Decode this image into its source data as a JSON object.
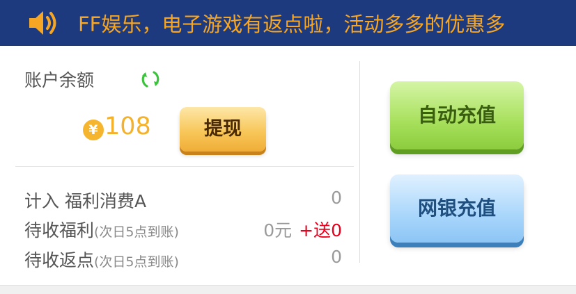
{
  "banner": {
    "icon": "speaker-icon",
    "text": "FF娱乐，电子游戏有返点啦，活动多多的优惠多",
    "bg_color": "#1e3a7e",
    "text_color": "#f6a623"
  },
  "account": {
    "balance_label": "账户余额",
    "refresh_icon": "refresh-icon",
    "currency_symbol": "¥",
    "balance": "108",
    "withdraw_label": "提现"
  },
  "details": [
    {
      "label": "计入 福利消费A",
      "note": "",
      "value": "0",
      "extra": ""
    },
    {
      "label": "待收福利",
      "note": "(次日5点到账)",
      "value": "0元",
      "extra": "+送0"
    },
    {
      "label": "待收返点",
      "note": "(次日5点到账)",
      "value": "0",
      "extra": ""
    }
  ],
  "actions": {
    "auto_recharge_label": "自动充值",
    "bank_recharge_label": "网银充值"
  }
}
